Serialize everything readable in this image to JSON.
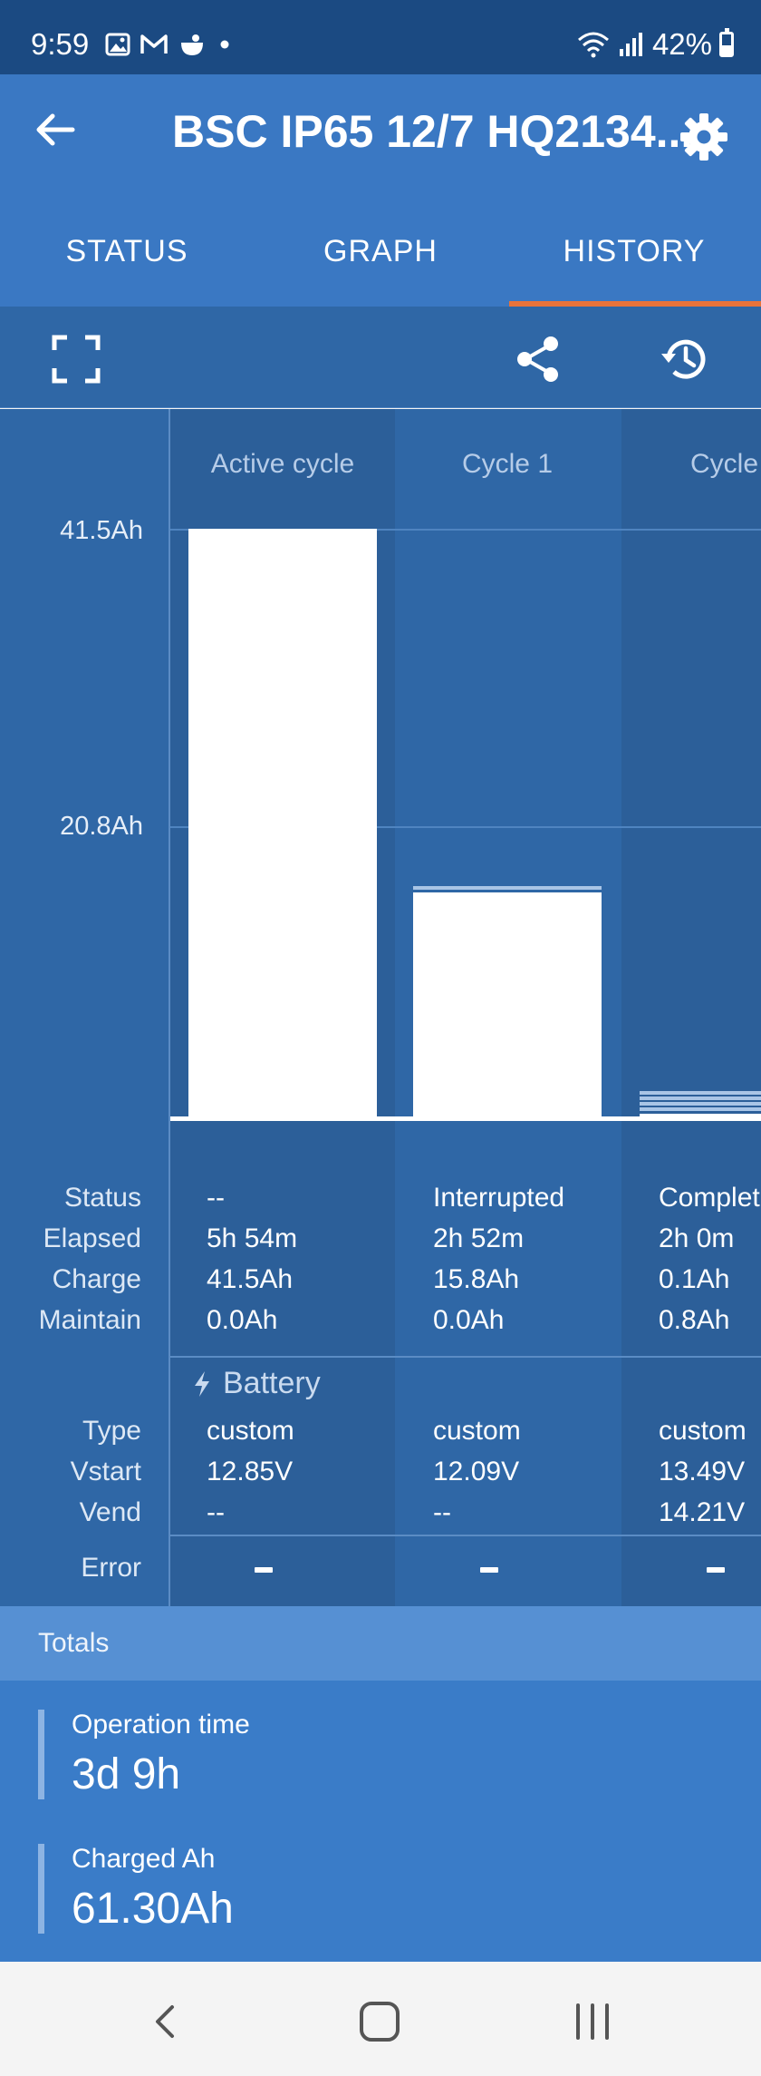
{
  "status_bar": {
    "time": "9:59",
    "battery": "42%"
  },
  "app_bar": {
    "title": "BSC IP65 12/7 HQ2134...",
    "back_icon": "back-arrow-icon",
    "settings_icon": "gear-icon"
  },
  "tabs": [
    {
      "label": "STATUS"
    },
    {
      "label": "GRAPH"
    },
    {
      "label": "HISTORY",
      "active": true
    }
  ],
  "toolbar": {
    "icons": [
      "fullscreen-icon",
      "share-icon",
      "history-icon"
    ]
  },
  "chart_data": {
    "type": "bar",
    "categories": [
      "Active cycle",
      "Cycle 1",
      "Cycle"
    ],
    "values": [
      41.5,
      15.8,
      0.1
    ],
    "y_ticks": [
      "41.5Ah",
      "20.8Ah"
    ],
    "ylim": [
      0,
      41.5
    ],
    "grid": true
  },
  "rows": {
    "labels": {
      "status": "Status",
      "elapsed": "Elapsed",
      "charge": "Charge",
      "maintain": "Maintain",
      "type": "Type",
      "vstart": "Vstart",
      "vend": "Vend",
      "error": "Error"
    },
    "battery_section": "Battery"
  },
  "cycles": [
    {
      "status": "--",
      "elapsed": "5h 54m",
      "charge": "41.5Ah",
      "maintain": "0.0Ah",
      "type": "custom",
      "vstart": "12.85V",
      "vend": "--",
      "error": "-"
    },
    {
      "status": "Interrupted",
      "elapsed": "2h 52m",
      "charge": "15.8Ah",
      "maintain": "0.0Ah",
      "type": "custom",
      "vstart": "12.09V",
      "vend": "--",
      "error": "-"
    },
    {
      "status": "Complet",
      "elapsed": "2h 0m",
      "charge": "0.1Ah",
      "maintain": "0.8Ah",
      "type": "custom",
      "vstart": "13.49V",
      "vend": "14.21V",
      "error": "-"
    }
  ],
  "totals": {
    "header": "Totals",
    "items": [
      {
        "label": "Operation time",
        "value": "3d 9h"
      },
      {
        "label": "Charged Ah",
        "value": "61.30Ah"
      }
    ]
  }
}
